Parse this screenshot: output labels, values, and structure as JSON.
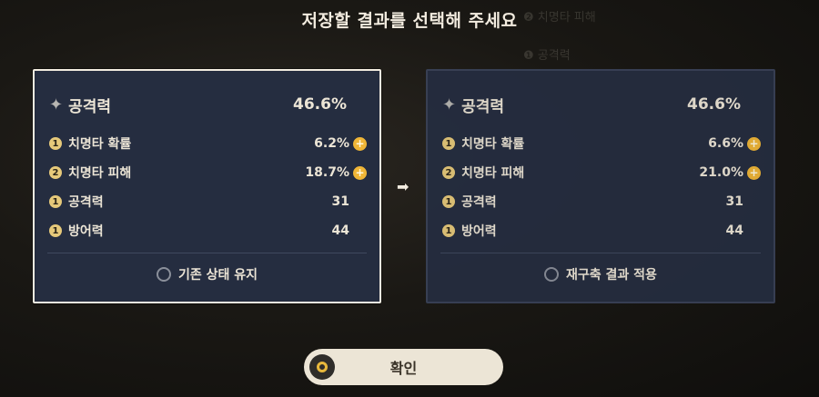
{
  "title": "저장할 결과를 선택해 주세요",
  "background": {
    "lines": [
      "❷ 치명타 피해",
      "❶ 공격력"
    ]
  },
  "left_card": {
    "main_stat": {
      "name": "공격력",
      "value": "46.6%"
    },
    "substats": [
      {
        "rolls": "1",
        "name": "치명타 확률",
        "value": "6.2%",
        "upgraded": true
      },
      {
        "rolls": "2",
        "name": "치명타 피해",
        "value": "18.7%",
        "upgraded": true
      },
      {
        "rolls": "1",
        "name": "공격력",
        "value": "31",
        "upgraded": false
      },
      {
        "rolls": "1",
        "name": "방어력",
        "value": "44",
        "upgraded": false
      }
    ],
    "option_label": "기존 상태 유지",
    "selected": true
  },
  "right_card": {
    "main_stat": {
      "name": "공격력",
      "value": "46.6%"
    },
    "substats": [
      {
        "rolls": "1",
        "name": "치명타 확률",
        "value": "6.6%",
        "upgraded": true
      },
      {
        "rolls": "2",
        "name": "치명타 피해",
        "value": "21.0%",
        "upgraded": true
      },
      {
        "rolls": "1",
        "name": "공격력",
        "value": "31",
        "upgraded": false
      },
      {
        "rolls": "1",
        "name": "방어력",
        "value": "44",
        "upgraded": false
      }
    ],
    "option_label": "재구축 결과 적용",
    "selected": false
  },
  "arrow_icon": "arrow-right-icon",
  "confirm_label": "확인",
  "colors": {
    "accent": "#e8b83c",
    "card_bg": "#252d40",
    "text": "#ece5d6"
  }
}
